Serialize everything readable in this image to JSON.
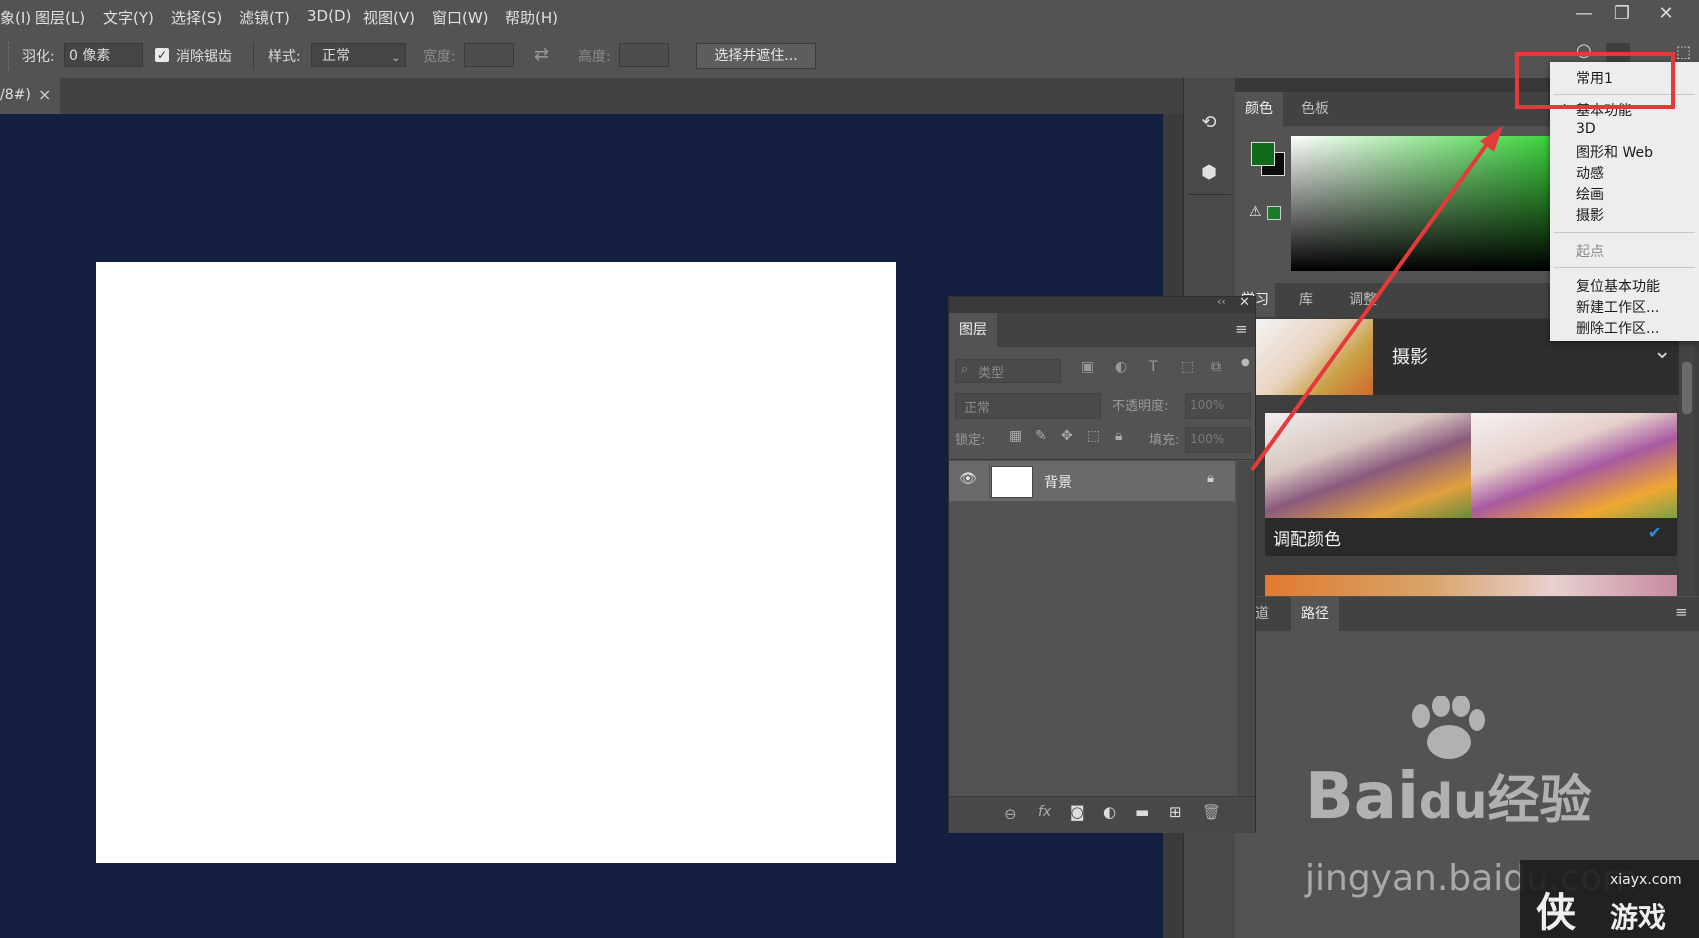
{
  "menubar": {
    "items": [
      "象(I)",
      "图层(L)",
      "文字(Y)",
      "选择(S)",
      "滤镜(T)",
      "3D(D)",
      "视图(V)",
      "窗口(W)",
      "帮助(H)"
    ],
    "window_buttons": [
      "—",
      "❐",
      "✕"
    ]
  },
  "optionsbar": {
    "feather_label": "羽化:",
    "feather_value": "0 像素",
    "antialias_label": "消除锯齿",
    "antialias_checked": true,
    "style_label": "样式:",
    "style_value": "正常",
    "width_label": "宽度:",
    "height_label": "高度:",
    "select_mask_button": "选择并遮住..."
  },
  "document": {
    "tab_label": "/8#)",
    "tab_close": "×"
  },
  "color_panel": {
    "tabs": [
      "颜色",
      "色板"
    ],
    "foreground": "#0f6a1c",
    "background": "#0b0b0b"
  },
  "learn_panel": {
    "tabs": [
      "学习",
      "库",
      "调整"
    ],
    "category_title": "摄影",
    "tutorial_title": "调配颜色"
  },
  "paths_panel": {
    "tabs": [
      "通道",
      "路径"
    ]
  },
  "layers_panel": {
    "tab": "图层",
    "filter_kind": "类型",
    "blend_mode": "正常",
    "opacity_label": "不透明度:",
    "opacity_value": "100%",
    "lock_label": "锁定:",
    "fill_label": "填充:",
    "fill_value": "100%",
    "layers": [
      {
        "name": "背景",
        "visible": true,
        "locked": true
      }
    ]
  },
  "workspace_menu": {
    "items": [
      {
        "label": "常用1",
        "checked": false,
        "disabled": false
      },
      {
        "label": "基本功能",
        "checked": true,
        "disabled": false
      },
      {
        "label": "3D",
        "checked": false,
        "disabled": false
      },
      {
        "label": "图形和 Web",
        "checked": false,
        "disabled": false
      },
      {
        "label": "动感",
        "checked": false,
        "disabled": false
      },
      {
        "label": "绘画",
        "checked": false,
        "disabled": false
      },
      {
        "label": "摄影",
        "checked": false,
        "disabled": false
      },
      {
        "label": "起点",
        "checked": false,
        "disabled": true
      },
      {
        "label": "复位基本功能",
        "checked": false,
        "disabled": false
      },
      {
        "label": "新建工作区...",
        "checked": false,
        "disabled": false
      },
      {
        "label": "删除工作区...",
        "checked": false,
        "disabled": false
      }
    ]
  },
  "watermark": {
    "brand_text": "Bai",
    "brand_du": "du",
    "brand_suffix": "经验",
    "url": "jingyan.baidu.com",
    "site": "xiayx.com",
    "site_cn": "游戏",
    "site_char": "侠"
  },
  "colors": {
    "annotation_red": "#e63a3a",
    "canvas_bg": "#141f40",
    "panel_bg": "#535353",
    "accent_blue": "#2a8fe0"
  }
}
